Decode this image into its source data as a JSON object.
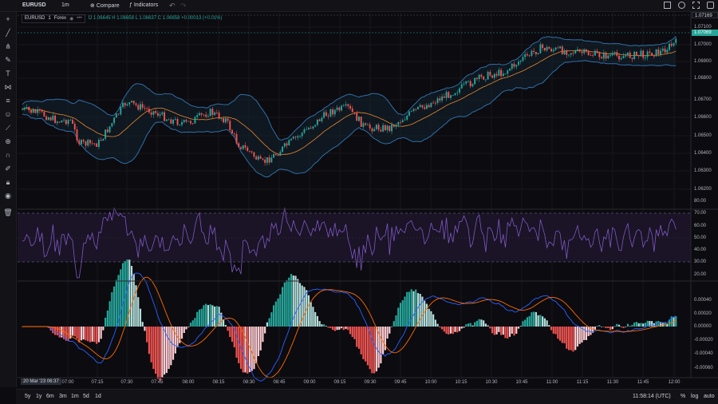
{
  "header": {
    "symbol": "EURUSD",
    "timeframe": "1m",
    "compare_label": "Compare",
    "indicators_label": "Indicators"
  },
  "legend": {
    "symbol": "EURUSD",
    "interval": "1",
    "market": "Forex",
    "ohlc": "O 1.06645  H 1.06658  L 1.06637  C 1.06658  +0.00013 (+0.01%)"
  },
  "price_axis": {
    "labels": [
      "1.07169",
      "1.07100",
      "1.07000",
      "1.06900",
      "1.06800",
      "1.06700",
      "1.06600",
      "1.06500",
      "1.06400",
      "1.06300",
      "1.06200"
    ],
    "last_price": "1.07069",
    "top_price": "1.07169"
  },
  "rsi_axis": [
    "80.00",
    "70.00",
    "60.00",
    "50.00",
    "40.00",
    "30.00",
    "20.00"
  ],
  "macd_axis": [
    "0.00040",
    "0.00020",
    "0.00000",
    "-0.00020",
    "-0.00040",
    "-0.00060"
  ],
  "time_axis": {
    "date_label": "20 Mar '23  06:37",
    "labels": [
      "07:00",
      "07:15",
      "07:30",
      "07:45",
      "08:00",
      "08:15",
      "08:30",
      "08:45",
      "09:00",
      "09:15",
      "09:30",
      "09:45",
      "10:00",
      "10:15",
      "10:30",
      "10:45",
      "11:00",
      "11:15",
      "11:30",
      "11:45",
      "12:00"
    ]
  },
  "ranges": [
    "5y",
    "1y",
    "6m",
    "3m",
    "1m",
    "5d",
    "1d"
  ],
  "footer": {
    "clock": "11:58:14 (UTC)",
    "percent": "%",
    "log": "log",
    "auto": "auto"
  },
  "colors": {
    "up": "#26a69a",
    "down": "#ef5350",
    "bb": "#2f6fa6",
    "ma": "#e8892d",
    "rsi": "#7e57c2",
    "macd": "#2962ff",
    "signal": "#ff6d00"
  }
}
